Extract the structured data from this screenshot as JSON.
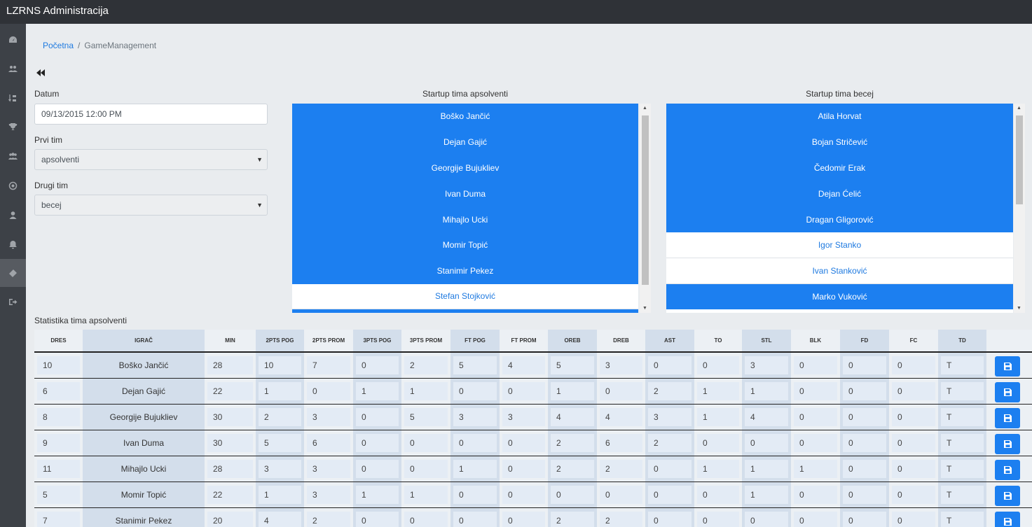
{
  "app": {
    "title": "LZRNS Administracija"
  },
  "sidebar": {
    "items": [
      {
        "icon": "dashboard-icon"
      },
      {
        "icon": "users-icon"
      },
      {
        "icon": "sort-icon"
      },
      {
        "icon": "trophy-icon"
      },
      {
        "icon": "teams-icon"
      },
      {
        "icon": "dot-circle-icon"
      },
      {
        "icon": "user-icon"
      },
      {
        "icon": "bell-icon"
      },
      {
        "icon": "ticket-icon",
        "active": true
      },
      {
        "icon": "sign-out-icon"
      }
    ]
  },
  "breadcrumb": {
    "home": "Početna",
    "separator": "/",
    "current": "GameManagement"
  },
  "form": {
    "datum_label": "Datum",
    "datum_value": "09/13/2015 12:00 PM",
    "prvi_tim_label": "Prvi tim",
    "prvi_tim_value": "apsolventi",
    "drugi_tim_label": "Drugi tim",
    "drugi_tim_value": "becej"
  },
  "startup_a": {
    "title": "Startup tima apsolventi",
    "players": [
      {
        "name": "Boško Jančić",
        "selected": true
      },
      {
        "name": "Dejan Gajić",
        "selected": true
      },
      {
        "name": "Georgije Bujukliev",
        "selected": true
      },
      {
        "name": "Ivan Duma",
        "selected": true
      },
      {
        "name": "Mihajlo Ucki",
        "selected": true
      },
      {
        "name": "Momir Topić",
        "selected": true
      },
      {
        "name": "Stanimir Pekez",
        "selected": true
      },
      {
        "name": "Stefan Stojković",
        "selected": false
      }
    ]
  },
  "startup_b": {
    "title": "Startup tima becej",
    "players": [
      {
        "name": "Atila Horvat",
        "selected": true
      },
      {
        "name": "Bojan Stričević",
        "selected": true
      },
      {
        "name": "Čedomir Erak",
        "selected": true
      },
      {
        "name": "Dejan Ćelić",
        "selected": true
      },
      {
        "name": "Dragan Gligorović",
        "selected": true
      },
      {
        "name": "Igor Stanko",
        "selected": false
      },
      {
        "name": "Ivan Stanković",
        "selected": false
      },
      {
        "name": "Marko Vuković",
        "selected": true
      }
    ]
  },
  "stats": {
    "title": "Statistika tima apsolventi",
    "columns": [
      "DRES",
      "IGRAČ",
      "MIN",
      "2PTS POG",
      "2PTS PROM",
      "3PTS POG",
      "3PTS PROM",
      "FT POG",
      "FT PROM",
      "OREB",
      "DREB",
      "AST",
      "TO",
      "STL",
      "BLK",
      "FD",
      "FC",
      "TD"
    ],
    "rows": [
      [
        "10",
        "Boško Jančić",
        "28",
        "10",
        "7",
        "0",
        "2",
        "5",
        "4",
        "5",
        "3",
        "0",
        "0",
        "3",
        "0",
        "0",
        "0",
        "T"
      ],
      [
        "6",
        "Dejan Gajić",
        "22",
        "1",
        "0",
        "1",
        "1",
        "0",
        "0",
        "1",
        "0",
        "2",
        "1",
        "1",
        "0",
        "0",
        "0",
        "T"
      ],
      [
        "8",
        "Georgije Bujukliev",
        "30",
        "2",
        "3",
        "0",
        "5",
        "3",
        "3",
        "4",
        "4",
        "3",
        "1",
        "4",
        "0",
        "0",
        "0",
        "T"
      ],
      [
        "9",
        "Ivan Duma",
        "30",
        "5",
        "6",
        "0",
        "0",
        "0",
        "0",
        "2",
        "6",
        "2",
        "0",
        "0",
        "0",
        "0",
        "0",
        "T"
      ],
      [
        "11",
        "Mihajlo Ucki",
        "28",
        "3",
        "3",
        "0",
        "0",
        "1",
        "0",
        "2",
        "2",
        "0",
        "1",
        "1",
        "1",
        "0",
        "0",
        "T"
      ],
      [
        "5",
        "Momir Topić",
        "22",
        "1",
        "3",
        "1",
        "1",
        "0",
        "0",
        "0",
        "0",
        "0",
        "0",
        "1",
        "0",
        "0",
        "0",
        "T"
      ],
      [
        "7",
        "Stanimir Pekez",
        "20",
        "4",
        "2",
        "0",
        "0",
        "0",
        "0",
        "2",
        "2",
        "0",
        "0",
        "0",
        "0",
        "0",
        "0",
        "T"
      ]
    ],
    "save_icon": "save-icon"
  }
}
